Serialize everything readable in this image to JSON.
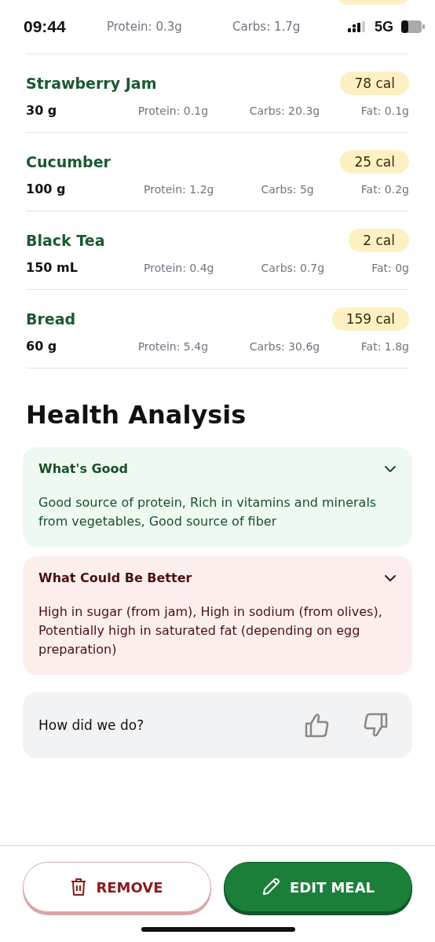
{
  "status_bar": {
    "time": "09:44",
    "network": "5G"
  },
  "partial_item": {
    "protein": "Protein: 0.3g",
    "carbs": "Carbs: 1.7g"
  },
  "food_items": [
    {
      "name": "Strawberry Jam",
      "calories": "78 cal",
      "amount": "30 g",
      "protein": "Protein: 0.1g",
      "carbs": "Carbs: 20.3g",
      "fat": "Fat: 0.1g"
    },
    {
      "name": "Cucumber",
      "calories": "25 cal",
      "amount": "100 g",
      "protein": "Protein: 1.2g",
      "carbs": "Carbs: 5g",
      "fat": "Fat: 0.2g"
    },
    {
      "name": "Black Tea",
      "calories": "2 cal",
      "amount": "150 mL",
      "protein": "Protein: 0.4g",
      "carbs": "Carbs: 0.7g",
      "fat": "Fat: 0g"
    },
    {
      "name": "Bread",
      "calories": "159 cal",
      "amount": "60 g",
      "protein": "Protein: 5.4g",
      "carbs": "Carbs: 30.6g",
      "fat": "Fat: 1.8g"
    }
  ],
  "health_analysis": {
    "title": "Health Analysis",
    "sections": [
      {
        "kind": "good",
        "title": "What's Good",
        "expanded": true,
        "text": "Good source of protein, Rich in vitamins and minerals from vegetables, Good source of fiber"
      },
      {
        "kind": "bad",
        "title": "What Could Be Better",
        "expanded": true,
        "text": "High in sugar (from jam), High in sodium (from olives), Potentially high in saturated fat (depending on egg preparation)"
      }
    ]
  },
  "feedback": {
    "question": "How did we do?"
  },
  "buttons": [
    {
      "kind": "remove",
      "label": "REMOVE"
    },
    {
      "kind": "edit",
      "label": "EDIT MEAL"
    }
  ]
}
